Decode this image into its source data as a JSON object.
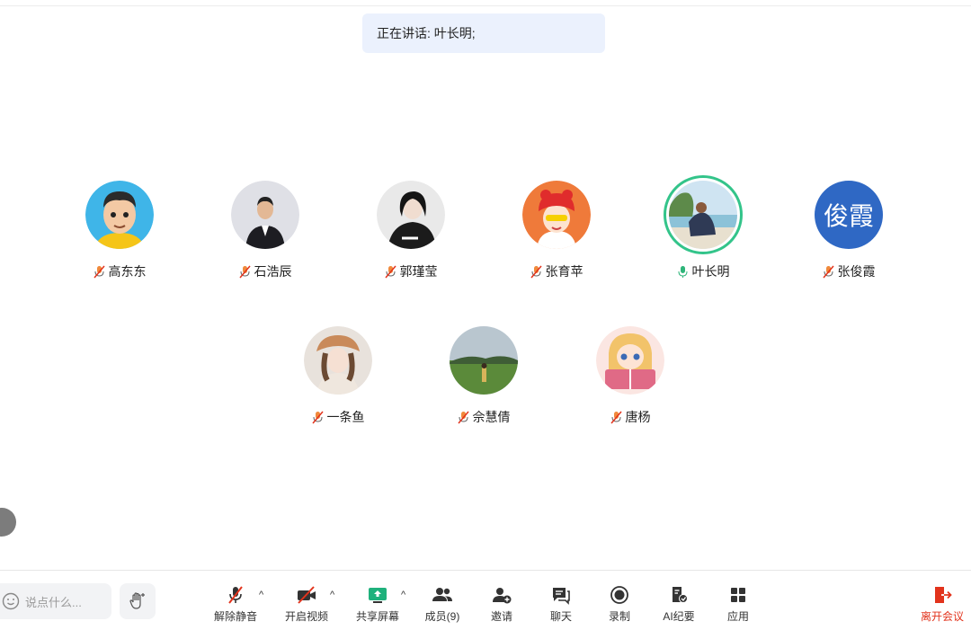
{
  "speaking": {
    "text": "正在讲话: 叶长明;"
  },
  "participants_row1": [
    {
      "name": "高东东",
      "avatar": "cartoon-man-avatar",
      "mic": "muted"
    },
    {
      "name": "石浩辰",
      "avatar": "suit-man-avatar",
      "mic": "muted"
    },
    {
      "name": "郭瑾莹",
      "avatar": "girl-hoodie-avatar",
      "mic": "muted"
    },
    {
      "name": "张育苹",
      "avatar": "cartoon-girl-frog-hat-avatar",
      "mic": "muted"
    },
    {
      "name": "叶长明",
      "avatar": "beach-photo-avatar",
      "mic": "speaking"
    },
    {
      "name": "张俊霞",
      "avatar_text": "俊霞",
      "mic": "muted"
    }
  ],
  "participants_row2": [
    {
      "name": "一条鱼",
      "avatar": "girl-hat-avatar",
      "mic": "muted"
    },
    {
      "name": "佘慧倩",
      "avatar": "field-landscape-avatar",
      "mic": "muted"
    },
    {
      "name": "唐杨",
      "avatar": "anime-girl-book-avatar",
      "mic": "muted"
    }
  ],
  "toolbar": {
    "chat_placeholder": "说点什么...",
    "unmute": "解除静音",
    "video": "开启视频",
    "share": "共享屏幕",
    "members": "成员(9)",
    "invite": "邀请",
    "chat": "聊天",
    "record": "录制",
    "ai_summary": "AI纪要",
    "apps": "应用",
    "leave": "离开会议"
  },
  "colors": {
    "accent_green": "#33c48a",
    "leave_red": "#e2331c",
    "avatar_blue": "#2f68c4",
    "banner_bg": "#ebf1fd"
  }
}
